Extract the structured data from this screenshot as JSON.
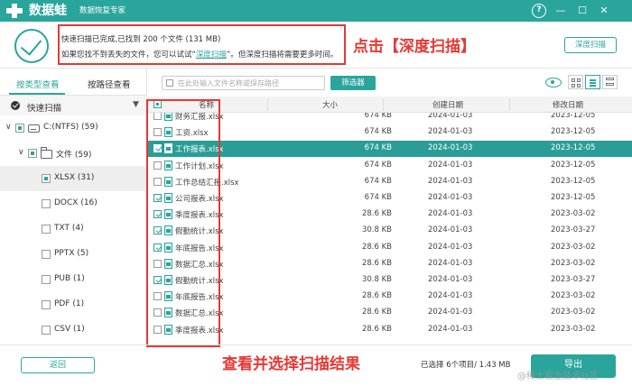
{
  "header": {
    "app_name": "数据蛙",
    "app_subtitle": "数据恢复专家",
    "help_label": "?",
    "minimize_label": "—",
    "maximize_label": "☐",
    "close_label": "✕"
  },
  "scan_info": {
    "line1": "快速扫描已完成,已找到 200 个文件 (131 MB)",
    "line2_prefix": "如果您找不到丢失的文件，您可以试试“",
    "line2_link": "深度扫描",
    "line2_suffix": "”。但深度扫描将需要更多时间。",
    "deep_scan_button": "深度扫描"
  },
  "annotations": {
    "top": "点击【深度扫描】",
    "bottom": "查看并选择扫描结果"
  },
  "left_panel": {
    "tabs": [
      {
        "label": "按类型查看",
        "active": true
      },
      {
        "label": "按路径查看",
        "active": false
      }
    ],
    "quick_scan_label": "快速扫描",
    "tree": [
      {
        "label": "C:(NTFS) (59)",
        "icon": "drive-icon"
      },
      {
        "label": "文件 (59)",
        "icon": "folder-icon"
      },
      {
        "label": "XLSX (31)",
        "selected": true
      },
      {
        "label": "DOCX (16)"
      },
      {
        "label": "TXT (4)"
      },
      {
        "label": "PPTX (5)"
      },
      {
        "label": "PUB (1)"
      },
      {
        "label": "PDF (1)"
      },
      {
        "label": "CSV (1)"
      }
    ],
    "back_button": "返回"
  },
  "toolbar": {
    "search_placeholder": "在此处输入文件名称或保存路径",
    "filter_button": "筛选器"
  },
  "table": {
    "headers": {
      "name": "名称",
      "size": "大小",
      "created": "创建日期",
      "modified": "修改日期"
    },
    "rows": [
      {
        "name": "财务汇报.xlsx",
        "size": "674 KB",
        "created": "2024-01-03",
        "modified": "2023-12-05",
        "checked": false,
        "selected": false
      },
      {
        "name": "工资.xlsx",
        "size": "674 KB",
        "created": "2024-01-03",
        "modified": "2023-12-05",
        "checked": false,
        "selected": false
      },
      {
        "name": "工作报表.xlsx",
        "size": "674 KB",
        "created": "2024-01-03",
        "modified": "2023-12-05",
        "checked": true,
        "selected": true
      },
      {
        "name": "工作计划.xlsx",
        "size": "674 KB",
        "created": "2024-01-03",
        "modified": "2023-12-05",
        "checked": false,
        "selected": false
      },
      {
        "name": "工作总结汇报.xlsx",
        "size": "674 KB",
        "created": "2024-01-03",
        "modified": "2023-12-05",
        "checked": false,
        "selected": false
      },
      {
        "name": "公司报表.xlsx",
        "size": "674 KB",
        "created": "2024-01-03",
        "modified": "2023-12-05",
        "checked": true,
        "selected": false
      },
      {
        "name": "季度报表.xlsx",
        "size": "28.6 KB",
        "created": "2024-01-03",
        "modified": "2023-03-02",
        "checked": true,
        "selected": false
      },
      {
        "name": "假勤统计.xlsx",
        "size": "30.8 KB",
        "created": "2024-01-03",
        "modified": "2023-03-27",
        "checked": true,
        "selected": false
      },
      {
        "name": "年底报告.xlsx",
        "size": "28.6 KB",
        "created": "2024-01-03",
        "modified": "2023-03-02",
        "checked": true,
        "selected": false
      },
      {
        "name": "数据汇总.xlsx",
        "size": "28.6 KB",
        "created": "2024-01-03",
        "modified": "2023-03-02",
        "checked": false,
        "selected": false
      },
      {
        "name": "假勤统计.xlsx",
        "size": "30.8 KB",
        "created": "2024-01-03",
        "modified": "2023-03-27",
        "checked": true,
        "selected": false
      },
      {
        "name": "年底报告.xlsx",
        "size": "28.6 KB",
        "created": "2024-01-03",
        "modified": "2023-03-02",
        "checked": false,
        "selected": false
      },
      {
        "name": "数据汇总.xlsx",
        "size": "28.6 KB",
        "created": "2024-01-03",
        "modified": "2023-03-02",
        "checked": false,
        "selected": false
      },
      {
        "name": "季度报表.xlsx",
        "size": "28.6 KB",
        "created": "2024-01-03",
        "modified": "2023-03-02",
        "checked": false,
        "selected": false
      }
    ]
  },
  "footer": {
    "status": "已选择 6个项目/ 1.43 MB",
    "export_button": "导出",
    "watermark": "@稀土掘金技术社区"
  },
  "colors": {
    "accent": "#2aa59c",
    "annotation": "#e53935"
  }
}
